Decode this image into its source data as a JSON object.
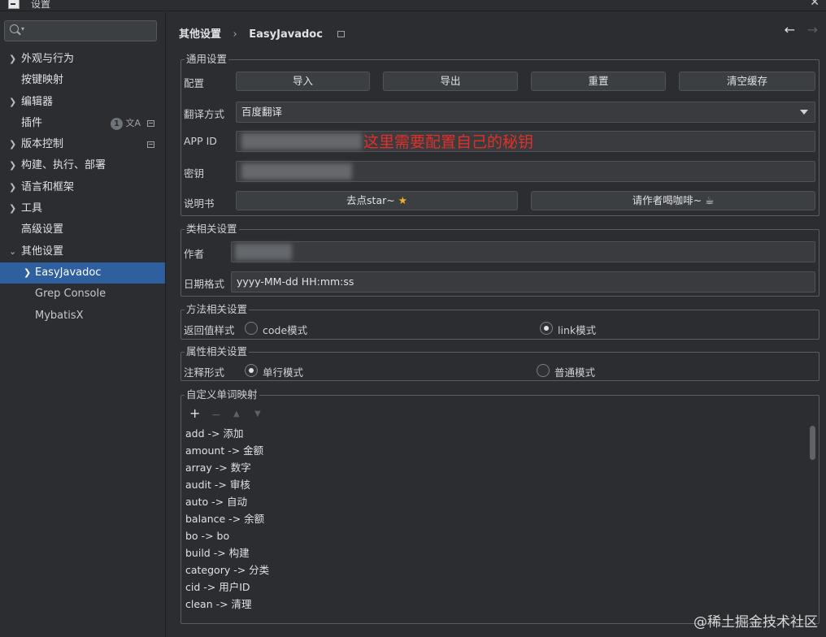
{
  "window": {
    "title": "设置",
    "close_glyph": "✕"
  },
  "sidebar": {
    "search_placeholder": "",
    "items": [
      {
        "label": "外观与行为",
        "expandable": true
      },
      {
        "label": "按键映射",
        "expandable": false
      },
      {
        "label": "编辑器",
        "expandable": true
      },
      {
        "label": "插件",
        "expandable": false,
        "badge": "1"
      },
      {
        "label": "版本控制",
        "expandable": true
      },
      {
        "label": "构建、执行、部署",
        "expandable": true
      },
      {
        "label": "语言和框架",
        "expandable": true
      },
      {
        "label": "工具",
        "expandable": true
      },
      {
        "label": "高级设置",
        "expandable": false
      },
      {
        "label": "其他设置",
        "expanded": true
      },
      {
        "label": "EasyJavadoc",
        "selected": true,
        "expandable": true
      },
      {
        "label": "Grep Console"
      },
      {
        "label": "MybatisX"
      }
    ]
  },
  "header": {
    "breadcrumb": [
      "其他设置",
      "EasyJavadoc"
    ],
    "separator": "›",
    "back_glyph": "←",
    "forward_glyph": "→"
  },
  "general": {
    "title": "通用设置",
    "config_label": "配置",
    "buttons": [
      "导入",
      "导出",
      "重置",
      "清空缓存"
    ],
    "translate_label": "翻译方式",
    "translate_value": "百度翻译",
    "appid_label": "APP ID",
    "appid_value": "",
    "secret_label": "密钥",
    "secret_value": "",
    "annotation": "这里需要配置自己的秘钥",
    "manual_label": "说明书",
    "star_button": "去点star~",
    "star_glyph": "★",
    "coffee_button": "请作者喝咖啡~",
    "coffee_glyph": "☕"
  },
  "class_settings": {
    "title": "类相关设置",
    "author_label": "作者",
    "author_value": "",
    "date_label": "日期格式",
    "date_value": "yyyy-MM-dd HH:mm:ss"
  },
  "method_settings": {
    "title": "方法相关设置",
    "return_label": "返回值样式",
    "option_code": "code模式",
    "option_link": "link模式",
    "selected": "link模式"
  },
  "field_settings": {
    "title": "属性相关设置",
    "comment_label": "注释形式",
    "option_single": "单行模式",
    "option_normal": "普通模式",
    "selected": "单行模式"
  },
  "word_mapping": {
    "title": "自定义单词映射",
    "toolbar": {
      "add": "+",
      "remove": "−",
      "up": "▲",
      "down": "▼"
    },
    "items": [
      "add -> 添加",
      "amount -> 金额",
      "array -> 数字",
      "audit -> 审核",
      "auto -> 自动",
      "balance -> 余额",
      "bo -> bo",
      "build -> 构建",
      "category -> 分类",
      "cid -> 用户ID",
      "clean -> 清理"
    ]
  },
  "watermark": "@稀土掘金技术社区"
}
